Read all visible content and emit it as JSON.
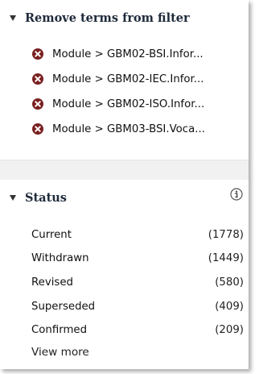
{
  "remove_section": {
    "title": "Remove terms from filter",
    "terms": [
      "Module > GBM02-BSI.Infor...",
      "Module > GBM02-IEC.Infor...",
      "Module > GBM02-ISO.Infor...",
      "Module > GBM03-BSI.Voca..."
    ]
  },
  "status_section": {
    "title": "Status",
    "info_icon": "info-icon",
    "facets": [
      {
        "label": "Current",
        "count": "(1778)"
      },
      {
        "label": "Withdrawn",
        "count": "(1449)"
      },
      {
        "label": "Revised",
        "count": "(580)"
      },
      {
        "label": "Superseded",
        "count": "(409)"
      },
      {
        "label": "Confirmed",
        "count": "(209)"
      }
    ],
    "view_more": "View more"
  },
  "colors": {
    "remove_icon": "#7a2020",
    "header_text": "#1e2a3a",
    "gap_background": "#f1f1f1"
  }
}
